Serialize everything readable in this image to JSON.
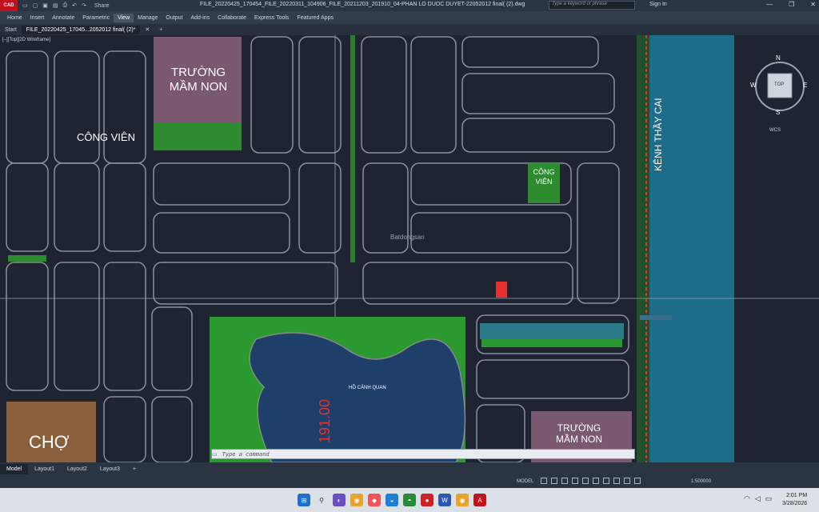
{
  "titlebar": {
    "app_logo": "CAD",
    "share": "Share",
    "file_title": "FILE_20220425_170454_FILE_20220311_104906_FILE_20211203_201910_04-PHAN LO DUOC DUYET-22052012 final( (2).dwg",
    "search_placeholder": "Type a keyword or phrase",
    "signin": "Sign In"
  },
  "ribbon": {
    "tabs": [
      "Home",
      "Insert",
      "Annotate",
      "Parametric",
      "View",
      "Manage",
      "Output",
      "Add-ins",
      "Collaborate",
      "Express Tools",
      "Featured Apps"
    ],
    "active": "View"
  },
  "doc_tabs": {
    "start": "Start",
    "file": "FILE_20220425_17045...2052012 final( (2)*"
  },
  "viewport": {
    "view_label": "[–][Top][2D Wireframe]",
    "labels": {
      "truong_mam_non_1": "TRƯỜNG\nMẦM NON",
      "cong_vien_1": "CÔNG VIÊN",
      "cong_vien_2": "CÔNG\nVIÊN",
      "kenh": "KÊNH THẦY CAI",
      "ho_canh_quan": "HỒ CẢNH QUAN",
      "dim": "191.00",
      "truong_mam_non_2": "TRƯỜNG\nMẦM NON",
      "cho": "CHỢ",
      "watermark": "Batdongsan"
    },
    "viewcube": {
      "n": "N",
      "s": "S",
      "e": "E",
      "w": "W",
      "top": "TOP",
      "wcs": "WCS"
    }
  },
  "command": {
    "placeholder": "Type a command"
  },
  "layout_tabs": [
    "Model",
    "Layout1",
    "Layout2",
    "Layout3"
  ],
  "layout_active": "Model",
  "status": {
    "model": "MODEL",
    "scale": "1:500000"
  },
  "taskbar": {
    "time": "2:01 PM",
    "date": "3/28/2026"
  },
  "colors": {
    "accent_red": "#c1121f",
    "green_fill": "#2e8b30",
    "canal": "#1d6c8a",
    "lake": "#1d3f6a"
  }
}
